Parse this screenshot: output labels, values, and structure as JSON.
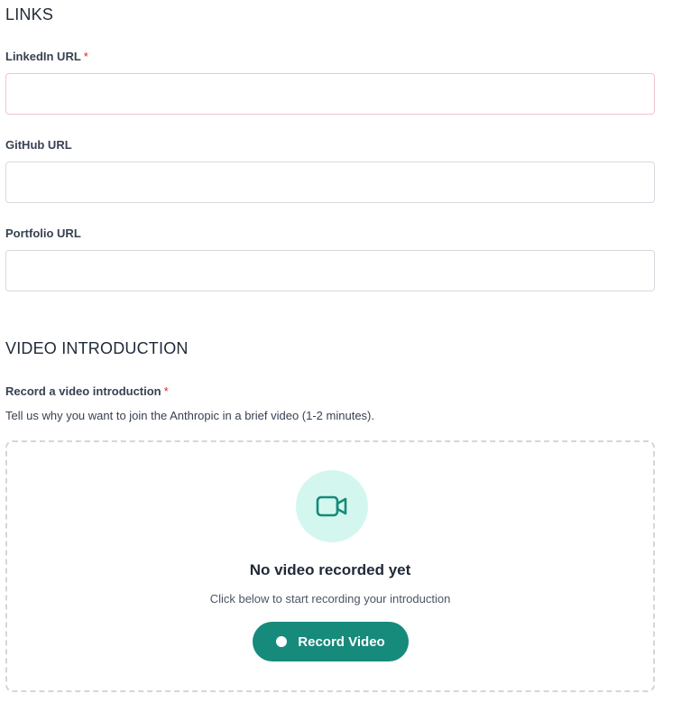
{
  "links": {
    "section_title": "LINKS",
    "linkedin": {
      "label": "LinkedIn URL",
      "required_mark": "*",
      "value": "",
      "placeholder": ""
    },
    "github": {
      "label": "GitHub URL",
      "value": "",
      "placeholder": ""
    },
    "portfolio": {
      "label": "Portfolio URL",
      "value": "",
      "placeholder": ""
    }
  },
  "video": {
    "section_title": "VIDEO INTRODUCTION",
    "label": "Record a video introduction",
    "required_mark": "*",
    "helper": "Tell us why you want to join the Anthropic in a brief video (1-2 minutes).",
    "empty_title": "No video recorded yet",
    "empty_subtitle": "Click below to start recording your introduction",
    "record_button_label": "Record Video",
    "icon": "video-camera-icon"
  },
  "colors": {
    "accent": "#168a7b",
    "icon_bg": "#d3f7ee",
    "required": "#dc2626"
  }
}
